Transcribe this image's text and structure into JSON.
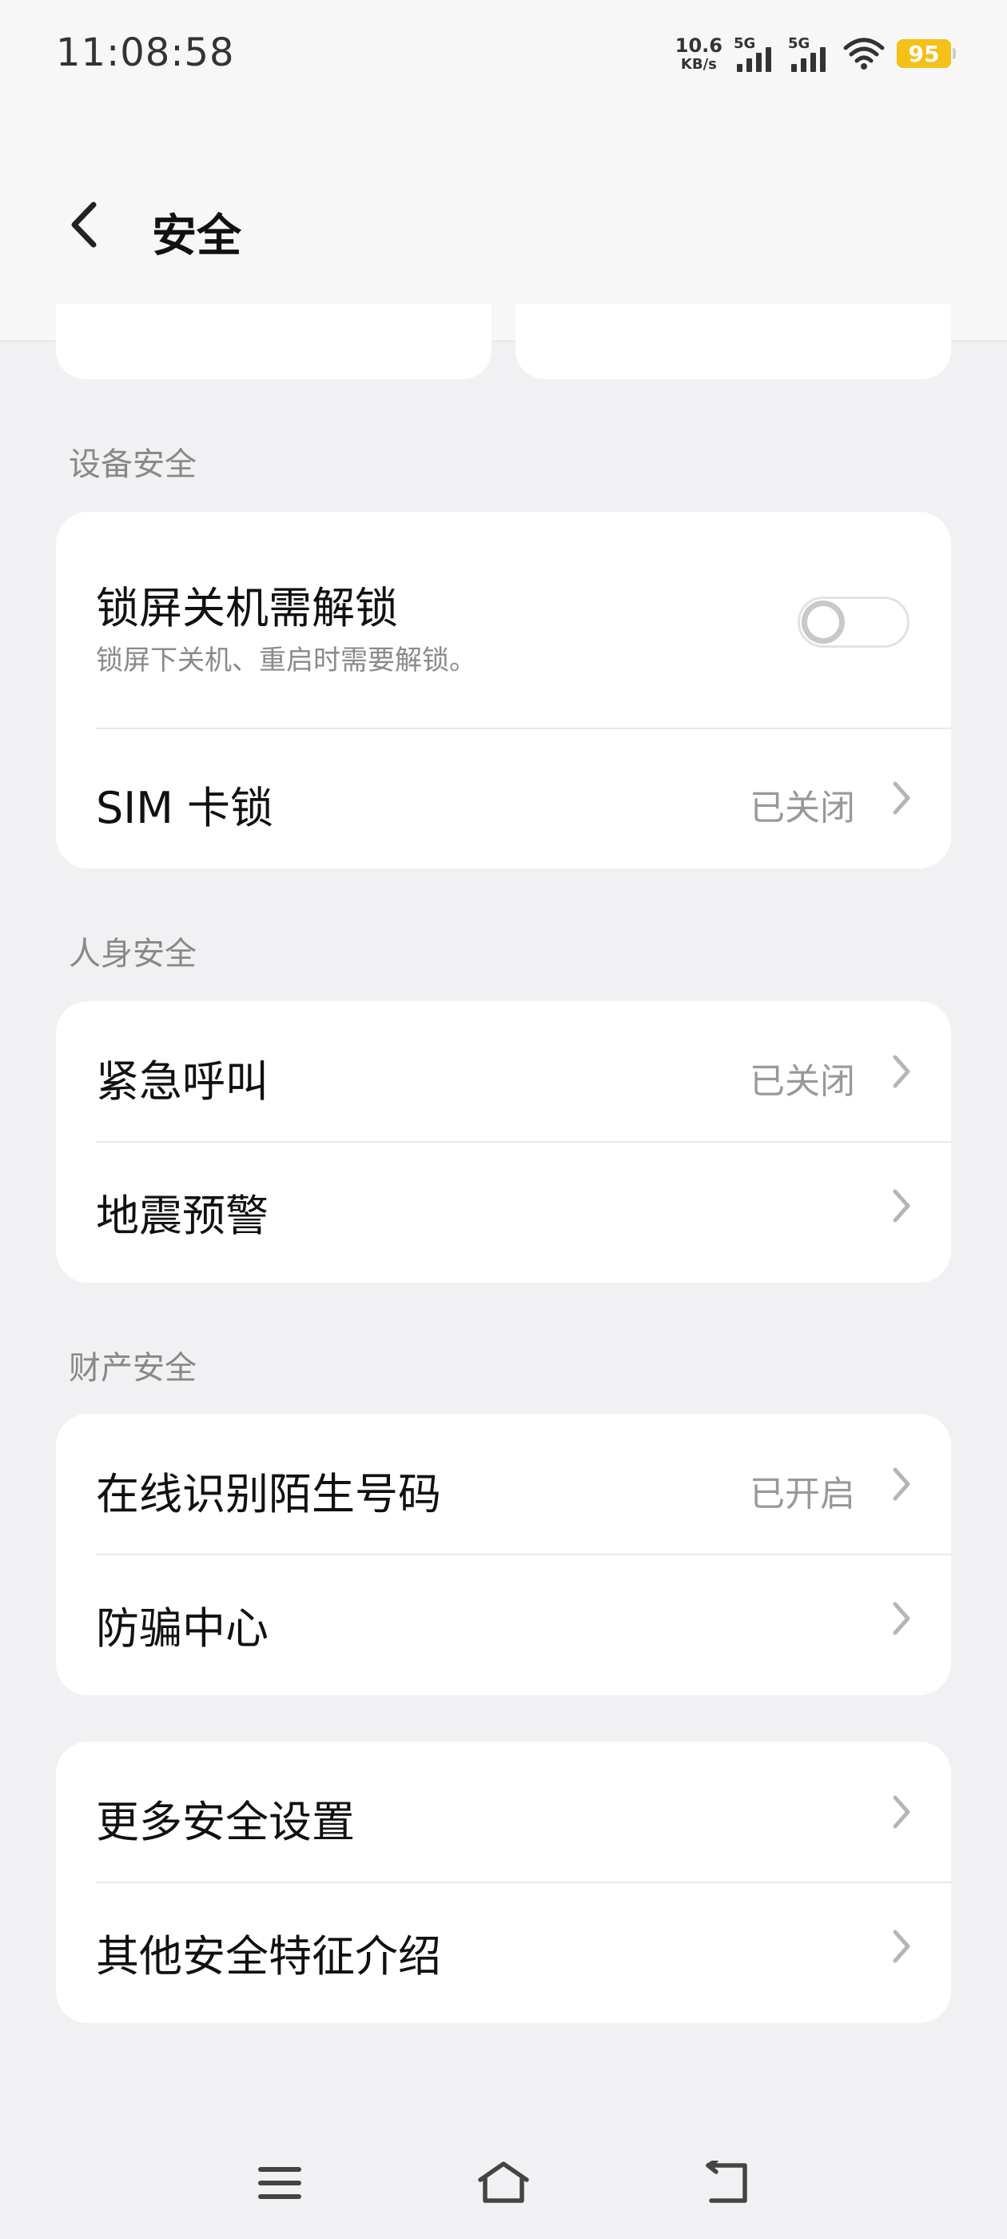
{
  "status_bar": {
    "time": "11:08:58",
    "net_speed_value": "10.6",
    "net_speed_unit": "KB/s",
    "signal1_label": "5G",
    "signal2_label": "5G",
    "battery": "95",
    "icons": [
      "signal-icon",
      "signal-icon",
      "wifi-icon",
      "battery-icon"
    ]
  },
  "header": {
    "title": "安全",
    "back_icon": "back-arrow-icon"
  },
  "sections": {
    "device": {
      "label": "设备安全",
      "lock_shutdown": {
        "label": "锁屏关机需解锁",
        "sub": "锁屏下关机、重启时需要解锁。",
        "toggle_on": false
      },
      "sim_lock": {
        "label": "SIM 卡锁",
        "value": "已关闭"
      }
    },
    "personal": {
      "label": "人身安全",
      "emergency_call": {
        "label": "紧急呼叫",
        "value": "已关闭"
      },
      "earthquake": {
        "label": "地震预警"
      }
    },
    "property": {
      "label": "财产安全",
      "caller_id": {
        "label": "在线识别陌生号码",
        "value": "已开启"
      },
      "anti_fraud": {
        "label": "防骗中心"
      }
    },
    "more": {
      "more_settings": {
        "label": "更多安全设置"
      },
      "other_features": {
        "label": "其他安全特征介绍"
      }
    }
  },
  "nav_bar": {
    "icons": [
      "menu-icon",
      "home-icon",
      "back-icon"
    ]
  },
  "colors": {
    "background": "#f1f1f3",
    "card": "#ffffff",
    "battery": "#f5c018",
    "secondary_text": "#999999"
  }
}
